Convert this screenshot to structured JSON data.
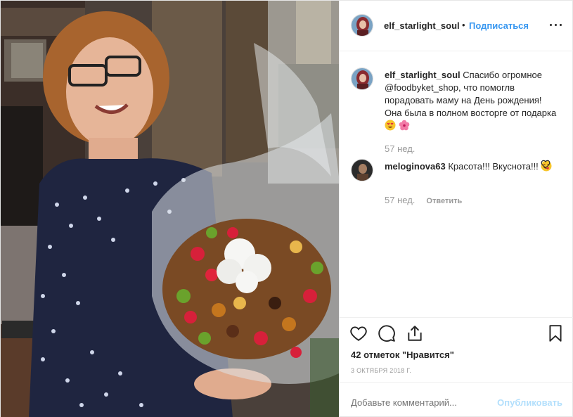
{
  "post": {
    "username": "elf_starlight_soul",
    "separator": "•",
    "follow_label": "Подписаться",
    "more_icon": "more-options-icon"
  },
  "comments": [
    {
      "username": "elf_starlight_soul",
      "text": "Спасибо огромное @foodbyket_shop, что помоглв порадовать маму на День рождения! Она была в полном восторге от подарка",
      "emojis": [
        "heart-eyes-emoji",
        "hibiscus-emoji"
      ],
      "time": "57 нед."
    },
    {
      "username": "meloginova63",
      "text": "Красота!!! Вкуснота!!!",
      "emojis": [
        "yum-face-emoji"
      ],
      "time": "57 нед.",
      "reply_label": "Ответить"
    }
  ],
  "actions": {
    "likes_text": "42 отметок \"Нравится\"",
    "date": "3 ОКТЯБРЯ 2018 Г."
  },
  "add_comment": {
    "placeholder": "Добавьте комментарий...",
    "post_label": "Опубликовать"
  },
  "colors": {
    "link": "#3897f0",
    "muted": "#999999",
    "text": "#262626",
    "post_disabled": "#b2dffc"
  }
}
